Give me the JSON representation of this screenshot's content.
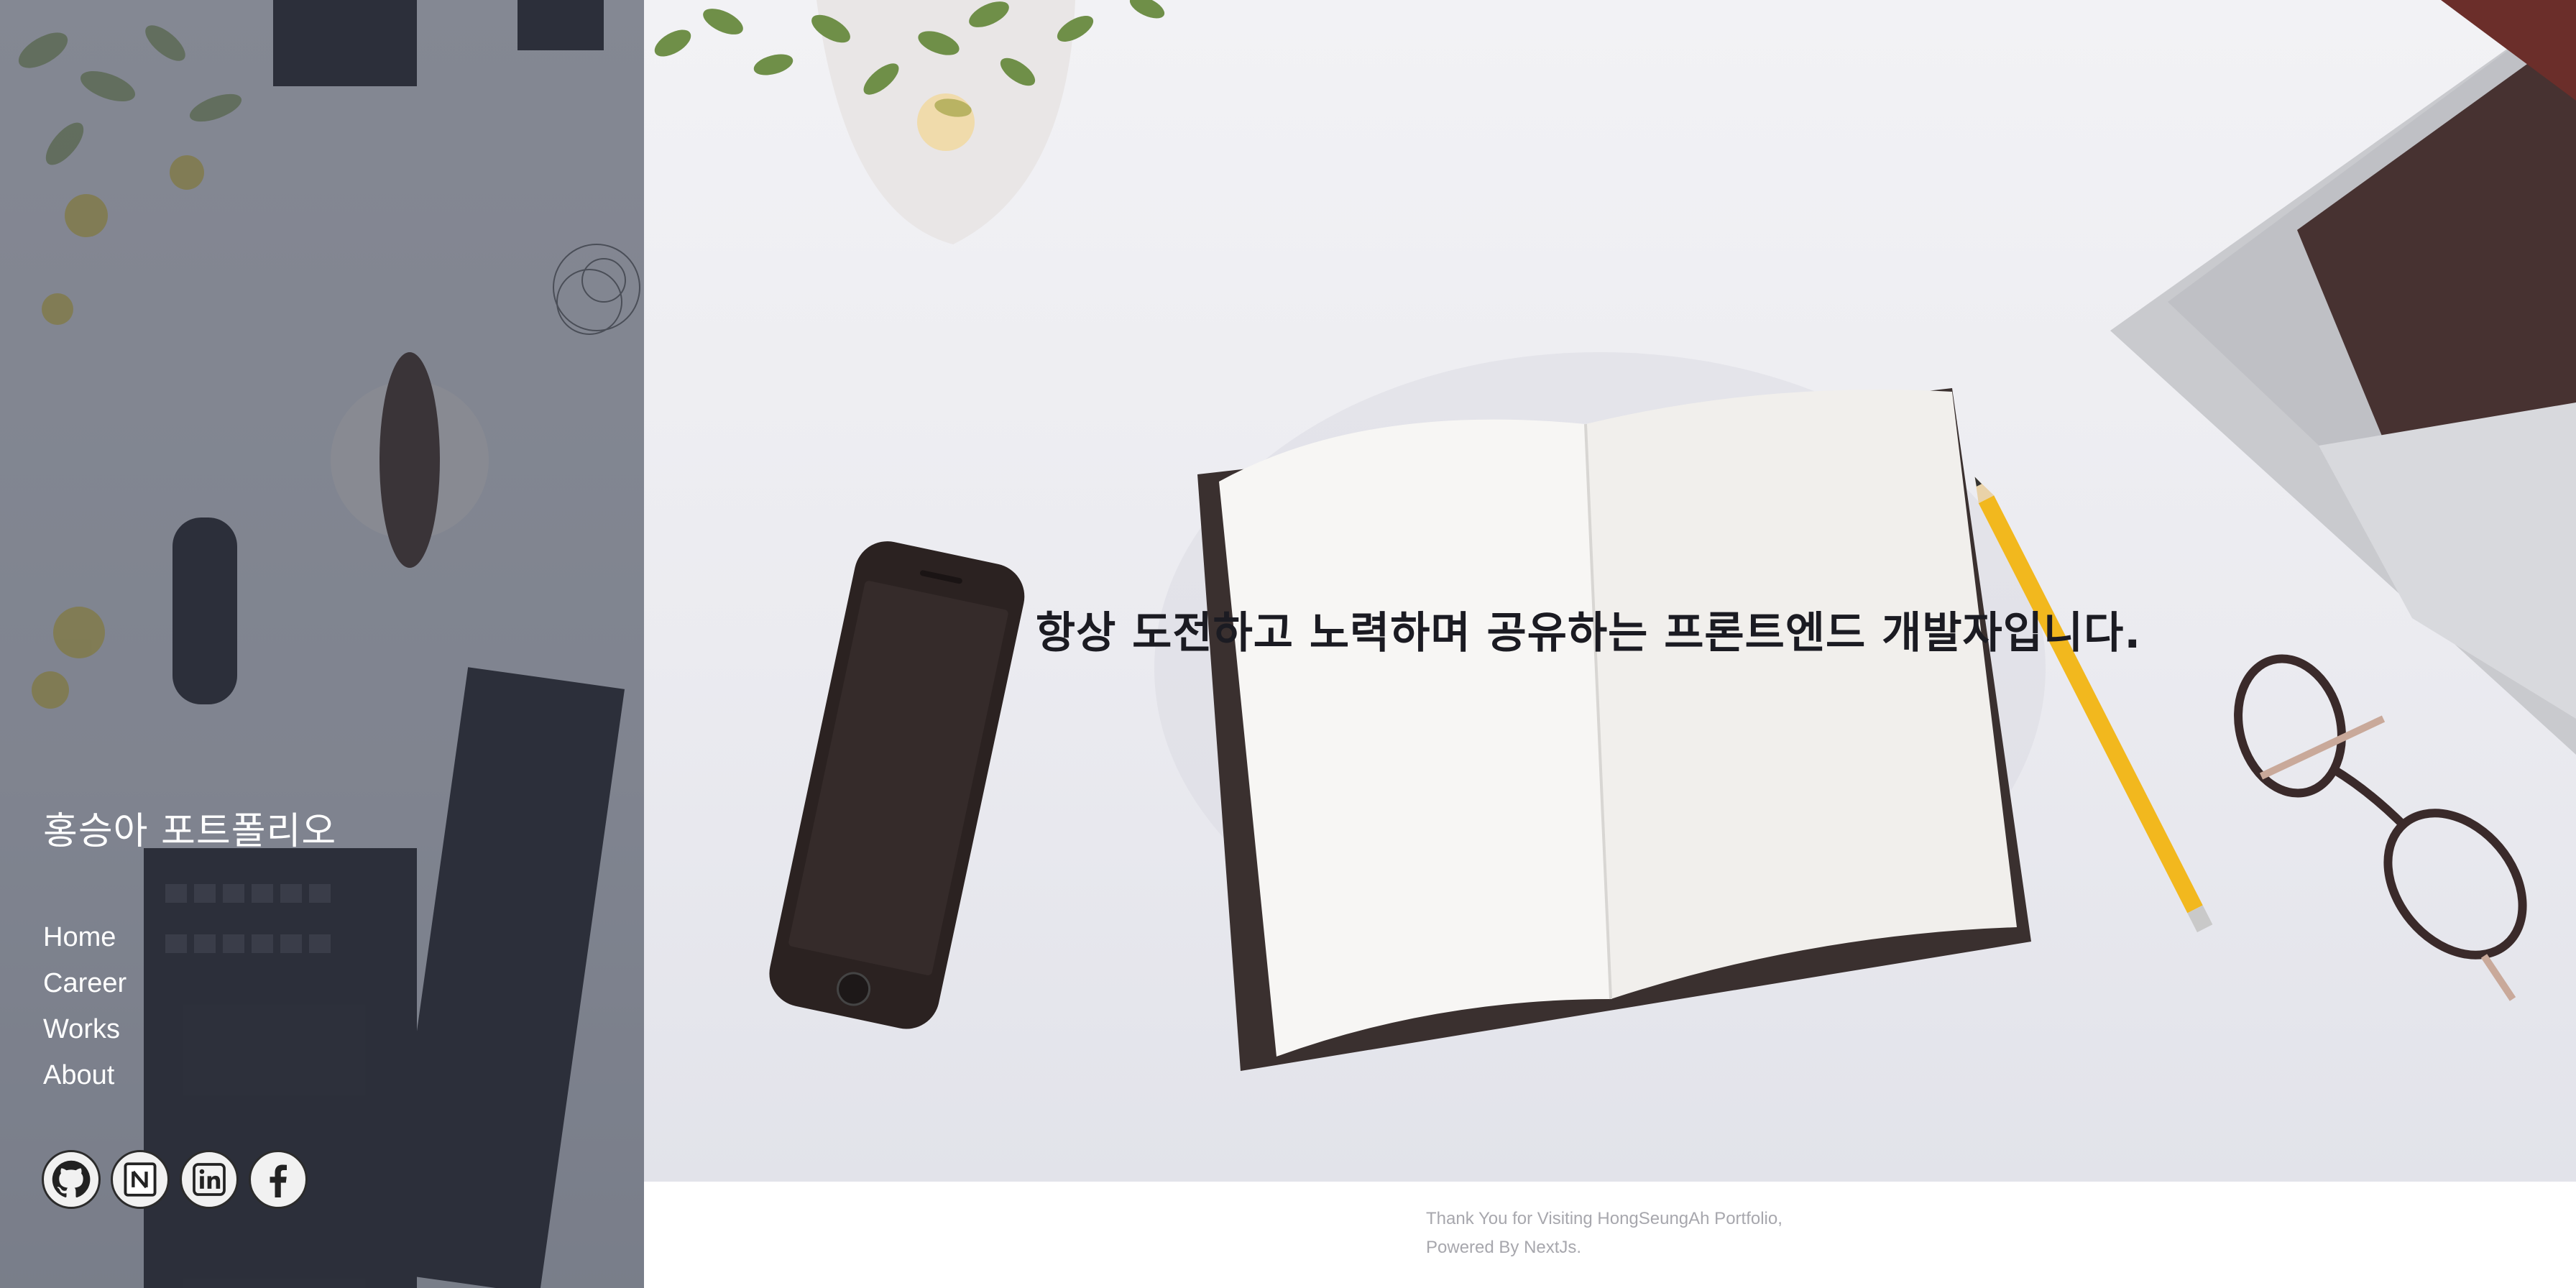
{
  "sidebar": {
    "title": "홍승아 포트폴리오",
    "nav": [
      "Home",
      "Career",
      "Works",
      "About"
    ],
    "social": [
      "github-icon",
      "notion-icon",
      "linkedin-icon",
      "facebook-icon"
    ]
  },
  "hero": {
    "heading": "항상 도전하고 노력하며 공유하는 프론트엔드 개발자입니다."
  },
  "footer": {
    "line1": "Thank You for Visiting HongSeungAh Portfolio,",
    "line2": "Powered By NextJs."
  },
  "colors": {
    "sidebar_overlay": "#3a4050",
    "heading": "#1b1b22",
    "footer_text": "#a7a7ad"
  }
}
